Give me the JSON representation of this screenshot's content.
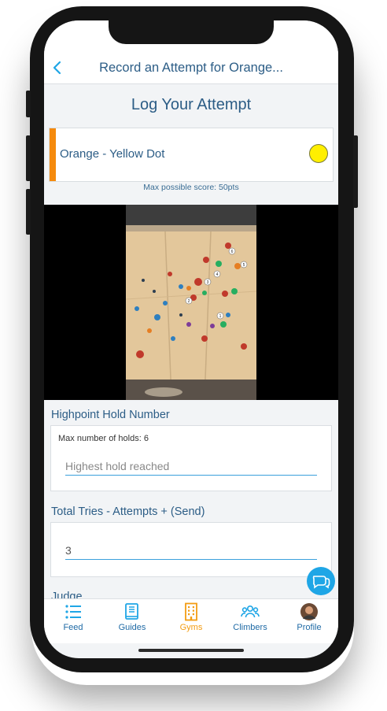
{
  "nav": {
    "title": "Record an Attempt for Orange..."
  },
  "page": {
    "title": "Log Your Attempt"
  },
  "route": {
    "name": "Orange - Yellow Dot",
    "stripe_color": "#f58a0d",
    "dot_color": "#ffef00",
    "max_score": "Max possible score: 50pts"
  },
  "video": {
    "hold_labels": [
      "6",
      "5",
      "4",
      "3",
      "2",
      "1"
    ]
  },
  "highpoint": {
    "label": "Highpoint Hold Number",
    "helper": "Max number of holds: 6",
    "placeholder": "Highest hold reached",
    "value": ""
  },
  "tries": {
    "label": "Total Tries - Attempts + (Send)",
    "value": "3"
  },
  "judge": {
    "label": "Judge"
  },
  "tabs": [
    {
      "label": "Feed",
      "icon": "list-icon",
      "active": false
    },
    {
      "label": "Guides",
      "icon": "book-icon",
      "active": false
    },
    {
      "label": "Gyms",
      "icon": "building-icon",
      "active": true
    },
    {
      "label": "Climbers",
      "icon": "people-icon",
      "active": false
    },
    {
      "label": "Profile",
      "icon": "avatar",
      "active": false
    }
  ],
  "colors": {
    "accent": "#2c5d86",
    "link": "#1fa6e6",
    "active_tab": "#f39c12"
  }
}
